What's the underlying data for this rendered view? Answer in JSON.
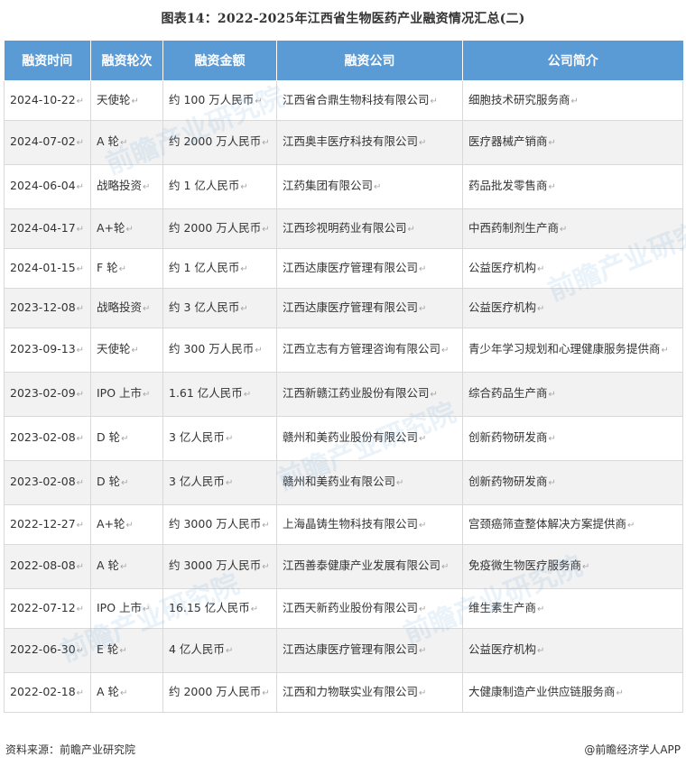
{
  "title": "图表14：2022-2025年江西省生物医药产业融资情况汇总(二)",
  "table": {
    "headers": [
      "融资时间",
      "融资轮次",
      "融资金额",
      "融资公司",
      "公司简介"
    ],
    "rows": [
      [
        "2024-10-22",
        "天使轮",
        "约 100 万人民币",
        "江西省合鼎生物科技有限公司",
        "细胞技术研究服务商"
      ],
      [
        "2024-07-02",
        "A 轮",
        "约 2000 万人民币",
        "江西奥丰医疗科技有限公司",
        "医疗器械产销商"
      ],
      [
        "2024-06-04",
        "战略投资",
        "约 1 亿人民币",
        "江药集团有限公司",
        "药品批发零售商"
      ],
      [
        "2024-04-17",
        "A+轮",
        "约 2000 万人民币",
        "江西珍视明药业有限公司",
        "中西药制剂生产商"
      ],
      [
        "2024-01-15",
        "F 轮",
        "约 1 亿人民币",
        "江西达康医疗管理有限公司",
        "公益医疗机构"
      ],
      [
        "2023-12-08",
        "战略投资",
        "约 3 亿人民币",
        "江西达康医疗管理有限公司",
        "公益医疗机构"
      ],
      [
        "2023-09-13",
        "天使轮",
        "约 300 万人民币",
        "江西立志有方管理咨询有限公司",
        "青少年学习规划和心理健康服务提供商"
      ],
      [
        "2023-02-09",
        "IPO 上市",
        "1.61 亿人民币",
        "江西新赣江药业股份有限公司",
        "综合药品生产商"
      ],
      [
        "2023-02-08",
        "D 轮",
        "3 亿人民币",
        "赣州和美药业股份有限公司",
        "创新药物研发商"
      ],
      [
        "2023-02-08",
        "D 轮",
        "3 亿人民币",
        "赣州和美药业有限公司",
        "创新药物研发商"
      ],
      [
        "2022-12-27",
        "A+轮",
        "约 3000 万人民币",
        "上海晶铸生物科技有限公司",
        "宫颈癌筛查整体解决方案提供商"
      ],
      [
        "2022-08-08",
        "A 轮",
        "约 3000 万人民币",
        "江西善泰健康产业发展有限公司",
        "免疫微生物医疗服务商"
      ],
      [
        "2022-07-12",
        "IPO 上市",
        "16.15 亿人民币",
        "江西天新药业股份有限公司",
        "维生素生产商"
      ],
      [
        "2022-06-30",
        "E 轮",
        "4 亿人民币",
        "江西达康医疗管理有限公司",
        "公益医疗机构"
      ],
      [
        "2022-02-18",
        "A 轮",
        "约 2000 万人民币",
        "江西和力物联实业有限公司",
        "大健康制造产业供应链服务商"
      ]
    ]
  },
  "footer": {
    "source": "资料来源：前瞻产业研究院",
    "brand": "@前瞻经济学人APP"
  },
  "watermark": "前瞻产业研究院",
  "colors": {
    "header_bg": "#5b9bd5",
    "stripe_bg": "#f2f2f2"
  }
}
